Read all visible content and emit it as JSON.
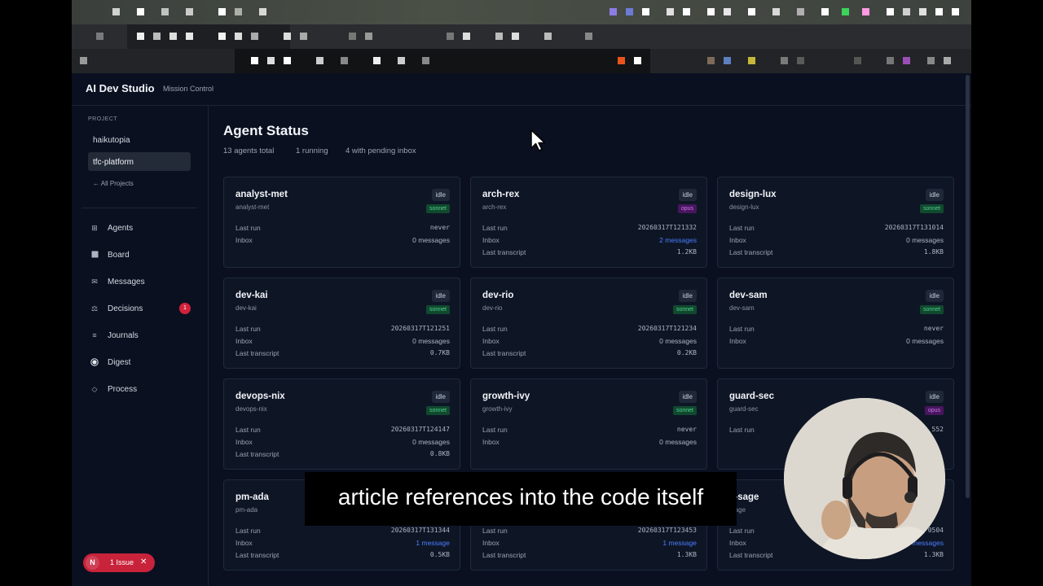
{
  "app": {
    "title": "AI Dev Studio",
    "subtitle": "Mission Control"
  },
  "sidebar": {
    "project_heading": "PROJECT",
    "projects": [
      "haikutopia",
      "tfc-platform"
    ],
    "selected_project": "tfc-platform",
    "all_projects_link": "← All Projects",
    "nav": [
      {
        "label": "Agents",
        "icon": "grid-icon"
      },
      {
        "label": "Board",
        "icon": "board-icon"
      },
      {
        "label": "Messages",
        "icon": "mail-icon"
      },
      {
        "label": "Decisions",
        "icon": "scale-icon",
        "badge": "1"
      },
      {
        "label": "Journals",
        "icon": "list-icon"
      },
      {
        "label": "Digest",
        "icon": "radio-icon"
      },
      {
        "label": "Process",
        "icon": "diamond-icon"
      }
    ],
    "issue_pill": {
      "icon_letter": "N",
      "label": "1 Issue",
      "close": "✕"
    }
  },
  "main": {
    "title": "Agent Status",
    "stats": [
      "13 agents total",
      "1 running",
      "4 with pending inbox"
    ],
    "labels": {
      "last_run": "Last run",
      "inbox": "Inbox",
      "last_transcript": "Last transcript"
    },
    "agents": [
      {
        "name": "analyst-met",
        "handle": "analyst-met",
        "status": "idle",
        "model": "sonnet",
        "last_run": "never",
        "inbox": "0 messages",
        "transcript": ""
      },
      {
        "name": "arch-rex",
        "handle": "arch-rex",
        "status": "idle",
        "model": "opus",
        "last_run": "20260317T121332",
        "inbox": "2 messages",
        "transcript": "1.2KB"
      },
      {
        "name": "design-lux",
        "handle": "design-lux",
        "status": "idle",
        "model": "sonnet",
        "last_run": "20260317T131014",
        "inbox": "0 messages",
        "transcript": "1.8KB"
      },
      {
        "name": "dev-kai",
        "handle": "dev-kai",
        "status": "idle",
        "model": "sonnet",
        "last_run": "20260317T121251",
        "inbox": "0 messages",
        "transcript": "0.7KB"
      },
      {
        "name": "dev-rio",
        "handle": "dev-rio",
        "status": "idle",
        "model": "sonnet",
        "last_run": "20260317T121234",
        "inbox": "0 messages",
        "transcript": "0.2KB"
      },
      {
        "name": "dev-sam",
        "handle": "dev-sam",
        "status": "idle",
        "model": "sonnet",
        "last_run": "never",
        "inbox": "0 messages",
        "transcript": ""
      },
      {
        "name": "devops-nix",
        "handle": "devops-nix",
        "status": "idle",
        "model": "sonnet",
        "last_run": "20260317T124147",
        "inbox": "0 messages",
        "transcript": "0.8KB"
      },
      {
        "name": "growth-ivy",
        "handle": "growth-ivy",
        "status": "idle",
        "model": "sonnet",
        "last_run": "never",
        "inbox": "0 messages",
        "transcript": ""
      },
      {
        "name": "guard-sec",
        "handle": "guard-sec",
        "status": "idle",
        "model": "opus",
        "last_run": "552",
        "inbox": "",
        "transcript": ""
      },
      {
        "name": "pm-ada",
        "handle": "pm-ada",
        "status": "",
        "model": "",
        "last_run": "20260317T131344",
        "inbox": "1 message",
        "transcript": "0.5KB"
      },
      {
        "name": "",
        "handle": "",
        "status": "",
        "model": "",
        "last_run": "20260317T123453",
        "inbox": "1 message",
        "transcript": "1.3KB"
      },
      {
        "name": "a-sage",
        "handle": "-sage",
        "status": "",
        "model": "",
        "last_run": "0504",
        "inbox": "messages",
        "transcript": "1.3KB"
      }
    ]
  },
  "caption": "article references into the code itself",
  "colors": {
    "background": "#0a1020",
    "card": "#0e1626",
    "accent_link": "#4a7dff",
    "badge_red": "#d4213a",
    "sonnet": "#4fd08a",
    "opus": "#c77ae8"
  }
}
